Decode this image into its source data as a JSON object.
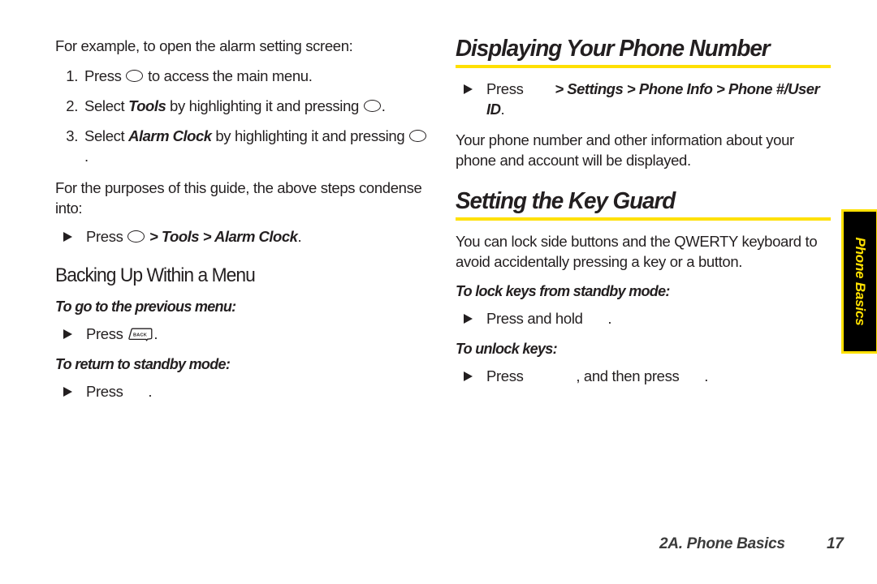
{
  "document": {
    "footer": {
      "chapter": "2A. Phone Basics",
      "page_number": "17"
    },
    "side_tab": {
      "label": "Phone Basics",
      "background_color": "#000000",
      "border_color": "#FFE000",
      "text_color": "#FFE000"
    },
    "accent_color": "#FFE000",
    "text_color": "#231F20"
  },
  "left_column": {
    "intro": "For example, to open the alarm setting screen:",
    "steps": [
      {
        "num": "1.",
        "before": "Press ",
        "key": "select-key-oval",
        "after": " to access the main menu."
      },
      {
        "num": "2.",
        "before": "Select ",
        "emphasis": "Tools",
        "mid": " by highlighting it and pressing ",
        "key": "select-key-oval",
        "after": "."
      },
      {
        "num": "3.",
        "before": "Select ",
        "emphasis": "Alarm Clock",
        "mid": " by highlighting it and pressing ",
        "key": "select-key-oval",
        "after": "."
      }
    ],
    "condense_note": "For the purposes of this guide, the above steps condense into:",
    "condense_bullet": {
      "before": "Press ",
      "key": "select-key-oval",
      "path": " > Tools > Alarm Clock",
      "after": "."
    },
    "subheading": "Backing Up Within a Menu",
    "prev_menu_lead": "To go to the previous menu:",
    "prev_menu_bullet": {
      "before": "Press ",
      "key": "back-key",
      "after": "."
    },
    "standby_lead": "To return to standby mode:",
    "standby_bullet": {
      "before": "Press ",
      "key": "end-key-missing-glyph",
      "after": "."
    }
  },
  "right_column": {
    "section1": {
      "heading": "Displaying Your Phone Number",
      "bullet": {
        "before": "Press ",
        "key": "menu-key-missing-glyph",
        "path": "> Settings > Phone Info > Phone #/User ID",
        "after": "."
      },
      "body": "Your phone number and other information about your phone and account will be displayed."
    },
    "section2": {
      "heading": "Setting the Key Guard",
      "body": "You can lock side buttons and the QWERTY keyboard to avoid accidentally pressing a key or a button.",
      "lock_lead": "To lock keys from standby mode:",
      "lock_bullet": {
        "before": "Press and hold ",
        "key": "lock-key-missing-glyph",
        "after": "."
      },
      "unlock_lead": "To unlock keys:",
      "unlock_bullet": {
        "before": "Press ",
        "key1": "unlock-key-missing-glyph",
        "mid": ", and then press ",
        "key2": "confirm-key-missing-glyph",
        "after": "."
      }
    }
  },
  "icons": {
    "back_key_label": "BACK",
    "bullet_glyph": "triangle-right"
  }
}
